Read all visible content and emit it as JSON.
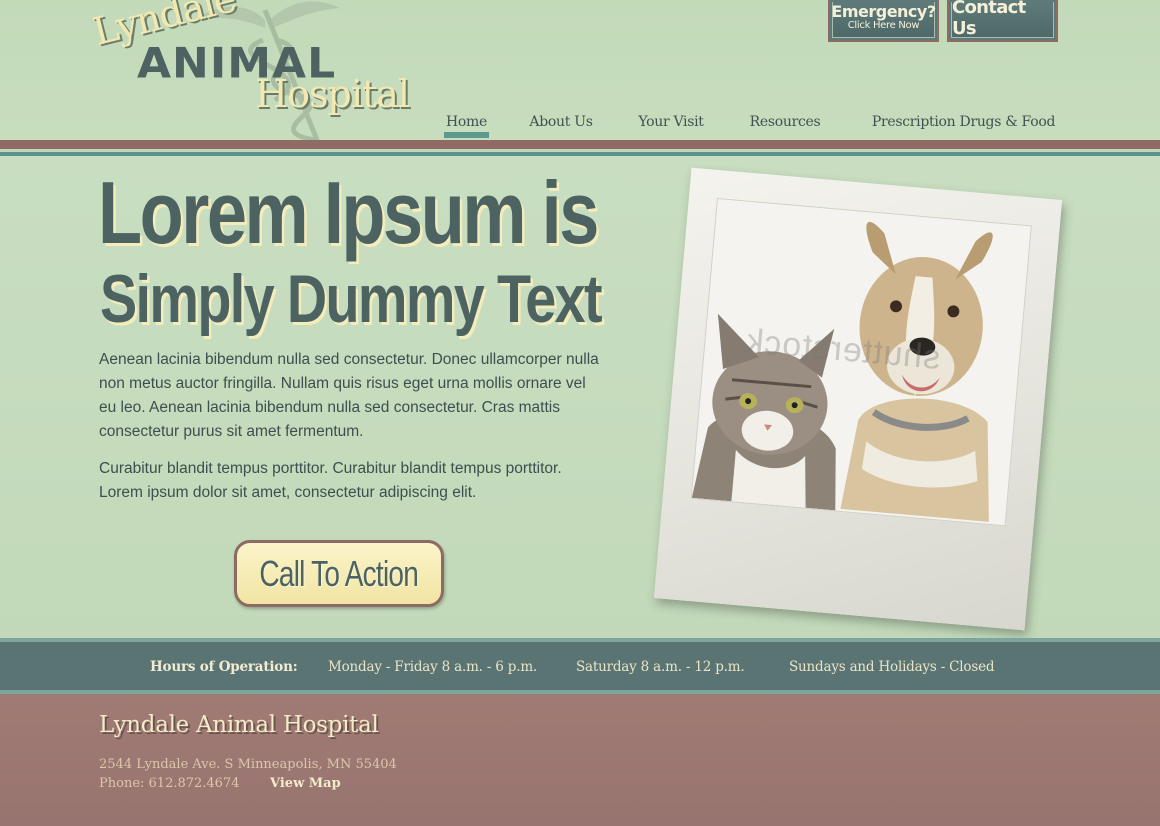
{
  "logo": {
    "line1": "Lyndale",
    "line2": "ANIMAL",
    "line3": "Hospital"
  },
  "header_buttons": {
    "emergency_title": "Emergency?",
    "emergency_sub": "Click Here Now",
    "contact": "Contact Us"
  },
  "nav": {
    "items": [
      {
        "label": "Home",
        "active": true
      },
      {
        "label": "About Us",
        "active": false
      },
      {
        "label": "Your Visit",
        "active": false
      },
      {
        "label": "Resources",
        "active": false
      },
      {
        "label": "Prescription Drugs & Food",
        "active": false
      }
    ]
  },
  "hero": {
    "headline_line1": "Lorem Ipsum is",
    "headline_line2": "Simply Dummy Text",
    "paragraph1": "Aenean lacinia bibendum nulla sed consectetur. Donec ullamcorper nulla non metus auctor fringilla. Nullam quis risus eget urna mollis ornare vel eu leo. Aenean lacinia bibendum nulla sed consectetur. Cras mattis consectetur purus sit amet fermentum.",
    "paragraph2": "Curabitur blandit tempus porttitor. Curabitur blandit tempus porttitor. Lorem ipsum dolor sit amet, consectetur adipiscing elit.",
    "cta": "Call To Action",
    "photo_watermark": "shutterstock"
  },
  "hours": {
    "label": "Hours of Operation:",
    "weekday": "Monday - Friday 8 a.m. - 6 p.m.",
    "saturday": "Saturday 8 a.m. - 12 p.m.",
    "sunday": "Sundays and Holidays - Closed"
  },
  "footer": {
    "title": "Lyndale Animal Hospital",
    "address": "2544 Lyndale Ave. S Minneapolis, MN 55404",
    "phone": "Phone:  612.872.4674",
    "map_link": "View Map"
  },
  "colors": {
    "page_green": "#c6dcbd",
    "slate": "#4c6362",
    "teal_accent": "#5c9a90",
    "mauve": "#8f6b64",
    "cream": "#f5ecbb"
  }
}
